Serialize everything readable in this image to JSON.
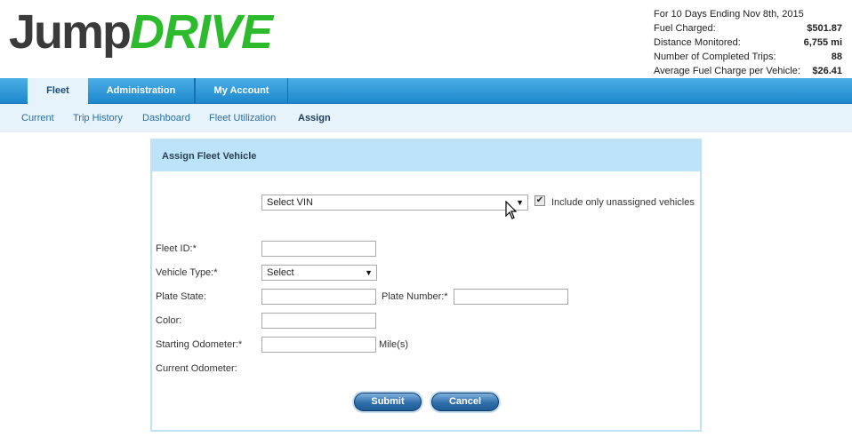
{
  "logo": {
    "part1": "Jump",
    "part2": "DRIVE"
  },
  "stats": {
    "period": "For 10 Days Ending Nov 8th, 2015",
    "rows": [
      {
        "label": "Fuel Charged:",
        "value": "$501.87"
      },
      {
        "label": "Distance Monitored:",
        "value": "6,755 mi"
      },
      {
        "label": "Number of Completed Trips:",
        "value": "88"
      },
      {
        "label": "Average Fuel Charge per Vehicle:",
        "value": "$26.41"
      }
    ]
  },
  "tabs": [
    {
      "label": "Fleet",
      "active": true
    },
    {
      "label": "Administration",
      "active": false
    },
    {
      "label": "My Account",
      "active": false
    }
  ],
  "subnav": [
    {
      "label": "Current"
    },
    {
      "label": "Trip History"
    },
    {
      "label": "Dashboard"
    },
    {
      "label": "Fleet Utilization"
    },
    {
      "label": "Assign",
      "active": true
    }
  ],
  "panel": {
    "title": "Assign Fleet Vehicle",
    "vin_select": {
      "value": "Select VIN"
    },
    "unassigned_checkbox": {
      "label": "Include only unassigned vehicles",
      "checked": true
    },
    "fleet_id_label": "Fleet ID:*",
    "vehicle_type_label": "Vehicle Type:*",
    "vehicle_type_select": {
      "value": "Select"
    },
    "plate_state_label": "Plate State:",
    "plate_number_label": "Plate Number:*",
    "color_label": "Color:",
    "starting_odometer_label": "Starting Odometer:*",
    "odometer_unit": "Mile(s)",
    "current_odometer_label": "Current Odometer:",
    "submit_label": "Submit",
    "cancel_label": "Cancel"
  },
  "icons": {
    "dropdown": "▼",
    "check": "✔"
  }
}
